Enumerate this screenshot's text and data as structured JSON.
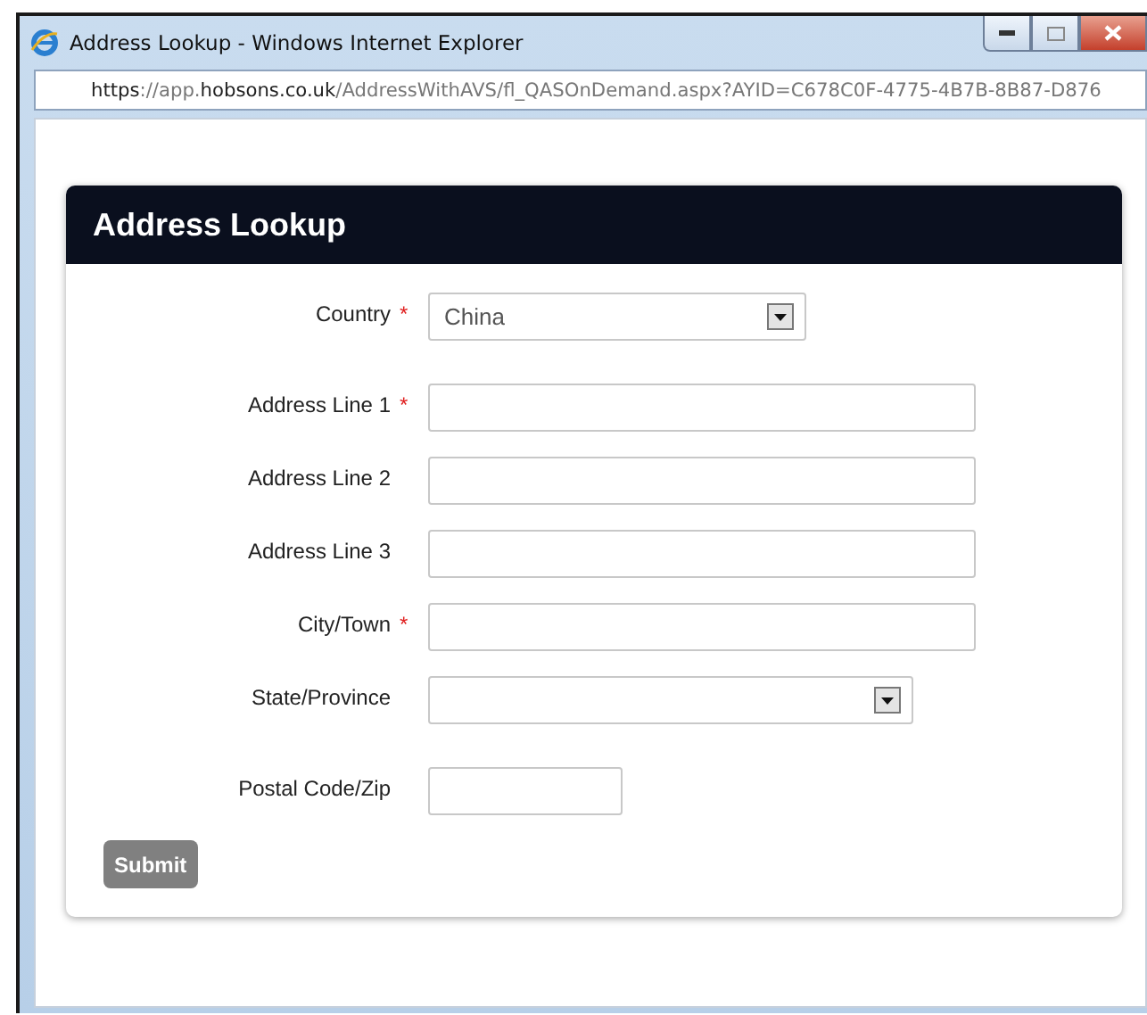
{
  "window": {
    "title": "Address Lookup - Windows Internet Explorer",
    "url": "**https**://app.**hobsons.co.uk**/AddressWithAVS/fl_QASOnDemand.aspx?AYID=C678C0F-4775-4B7B-8B87-D876"
  },
  "dialog": {
    "title": "Address Lookup",
    "fields": [
      {
        "kind": "select",
        "label": "Country",
        "required": true,
        "value": "China"
      },
      {
        "kind": "text",
        "label": "Address Line 1",
        "required": true
      },
      {
        "kind": "text",
        "label": "Address Line 2",
        "required": false
      },
      {
        "kind": "text",
        "label": "Address Line 3",
        "required": false
      },
      {
        "kind": "text",
        "label": "City/Town",
        "required": true
      },
      {
        "kind": "select",
        "label": "State/Province",
        "required": false
      },
      {
        "kind": "short",
        "label": "Postal Code/Zip",
        "required": false
      }
    ],
    "required_mark": "*",
    "submit": "Submit"
  }
}
